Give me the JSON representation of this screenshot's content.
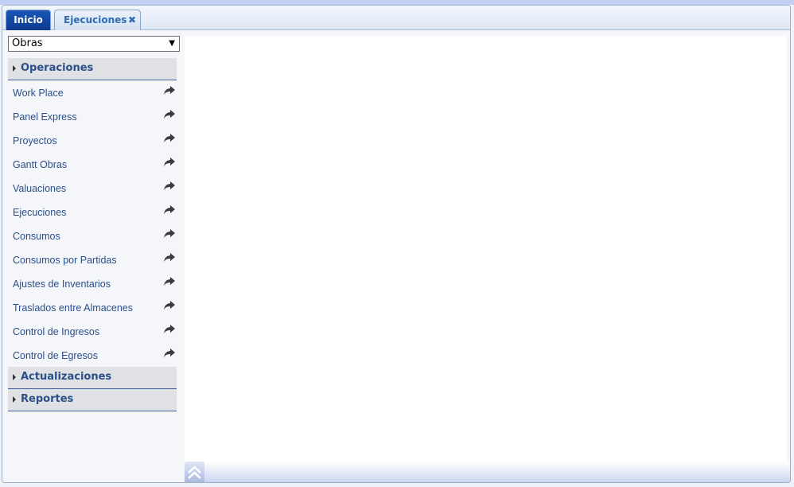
{
  "tabs": [
    {
      "label": "Inicio"
    },
    {
      "label": "Ejecuciones",
      "close": "✖"
    }
  ],
  "selector": {
    "value": "Obras",
    "arrow": "▼"
  },
  "sections": {
    "operaciones": {
      "title": "Operaciones",
      "items": [
        {
          "label": "Work Place"
        },
        {
          "label": "Panel Express"
        },
        {
          "label": "Proyectos"
        },
        {
          "label": "Gantt Obras"
        },
        {
          "label": "Valuaciones"
        },
        {
          "label": "Ejecuciones"
        },
        {
          "label": "Consumos"
        },
        {
          "label": "Consumos por Partidas"
        },
        {
          "label": "Ajustes de Inventarios"
        },
        {
          "label": "Traslados entre Almacenes"
        },
        {
          "label": "Control de Ingresos"
        },
        {
          "label": "Control de Egresos"
        }
      ]
    },
    "actualizaciones": {
      "title": "Actualizaciones"
    },
    "reportes": {
      "title": "Reportes"
    }
  },
  "icons": {
    "item_action": "share-arrow-icon",
    "collapse": "double-chevron-up-icon"
  }
}
